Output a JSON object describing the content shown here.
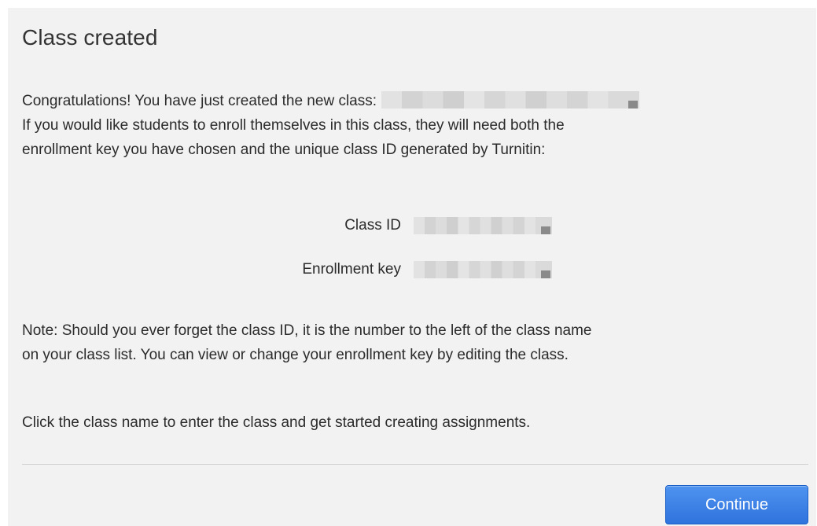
{
  "dialog": {
    "title": "Class created",
    "intro_line1": "Congratulations! You have just created the new class:",
    "intro_line2": "If you would like students to enroll themselves in this class, they will need both the",
    "intro_line3": "enrollment key you have chosen and the unique class ID generated by Turnitin:",
    "fields": {
      "class_id_label": "Class ID",
      "enrollment_key_label": "Enrollment key"
    },
    "note_line1": "Note: Should you ever forget the class ID, it is the number to the left of the class name",
    "note_line2": "on your class list. You can view or change your enrollment key by editing the class.",
    "click_hint": "Click the class name to enter the class and get started creating assignments.",
    "continue_label": "Continue"
  },
  "colors": {
    "dialog_background": "#f2f2f2",
    "button_blue": "#3a7fe6",
    "text": "#2b2b2b"
  }
}
